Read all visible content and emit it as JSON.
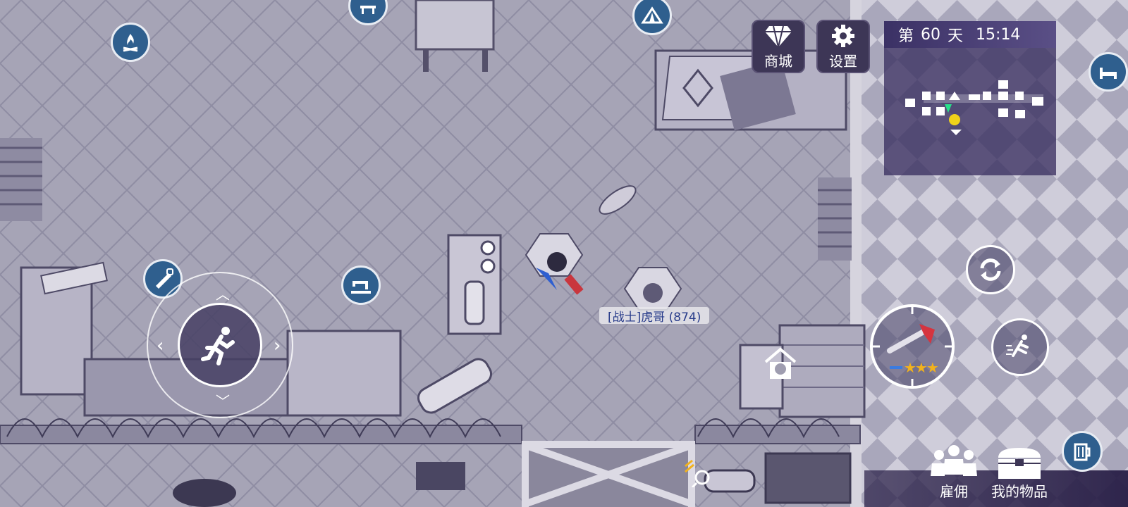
{
  "hud": {
    "shop_label": "商城",
    "settings_label": "设置",
    "day_prefix": "第",
    "day_number": "60",
    "day_suffix": "天",
    "clock": "15:14"
  },
  "player_tag": "[战士]虎哥 (874)",
  "weapon": {
    "stars": 3,
    "icon": "fire-axe-icon"
  },
  "bottom_menu": {
    "hire_label": "雇佣",
    "items_label": "我的物品"
  },
  "poi_icons": [
    "campfire-icon",
    "workbench-icon",
    "tent-icon",
    "bed-icon",
    "saw-icon",
    "sewing-machine-icon",
    "dog-house-icon",
    "beer-mug-icon"
  ],
  "colors": {
    "poi_fill": "#2f5f8e",
    "hud_dark": "#3d3656",
    "star": "#f2b21c",
    "name_text": "#273b8a"
  }
}
